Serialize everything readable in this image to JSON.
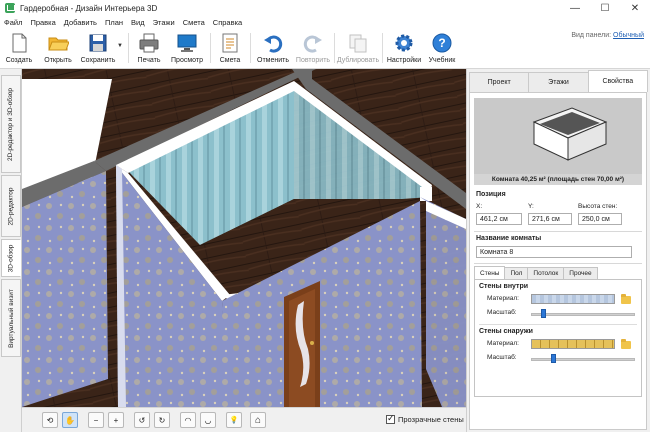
{
  "window": {
    "title": "Гардеробная - Дизайн Интерьера 3D",
    "controls": {
      "minimize": "—",
      "maximize": "☐",
      "close": "✕"
    }
  },
  "menu": [
    "Файл",
    "Правка",
    "Добавить",
    "План",
    "Вид",
    "Этажи",
    "Смета",
    "Справка"
  ],
  "toolbar": {
    "buttons": [
      {
        "label": "Создать",
        "icon": "new-document-icon"
      },
      {
        "label": "Открыть",
        "icon": "open-folder-icon"
      },
      {
        "label": "Сохранить",
        "icon": "save-disk-icon"
      },
      {
        "label": "Печать",
        "icon": "printer-icon"
      },
      {
        "label": "Просмотр",
        "icon": "monitor-icon"
      },
      {
        "label": "Смета",
        "icon": "estimate-notepad-icon"
      },
      {
        "label": "Отменить",
        "icon": "undo-icon"
      },
      {
        "label": "Повторить",
        "icon": "redo-icon",
        "disabled": true
      },
      {
        "label": "Дублировать",
        "icon": "duplicate-icon",
        "disabled": true
      },
      {
        "label": "Настройки",
        "icon": "gear-icon"
      },
      {
        "label": "Учебник",
        "icon": "help-icon"
      }
    ],
    "view_panel_label": "Вид панели:",
    "view_panel_value": "Обычный"
  },
  "side_tabs": [
    "2D-редактор и 3D-обзор",
    "2D-редактор",
    "3D-обзор",
    "Виртуальный визит"
  ],
  "active_side_tab": 2,
  "bottom_toolbar": {
    "buttons": [
      {
        "icon": "rotate-360-icon",
        "glyph": "⟲"
      },
      {
        "icon": "hand-pan-icon",
        "glyph": "✋",
        "active": true
      },
      {
        "icon": "zoom-out-icon",
        "glyph": "−"
      },
      {
        "icon": "zoom-in-icon",
        "glyph": "+"
      },
      {
        "icon": "rotate-left-icon",
        "glyph": "↺"
      },
      {
        "icon": "rotate-right-icon",
        "glyph": "↻"
      },
      {
        "icon": "tilt-up-icon",
        "glyph": "◠"
      },
      {
        "icon": "tilt-down-icon",
        "glyph": "◡"
      },
      {
        "icon": "light-bulb-icon",
        "glyph": "💡"
      },
      {
        "icon": "home-icon",
        "glyph": "⌂"
      }
    ],
    "transparent_walls_label": "Прозрачные стены",
    "transparent_walls_checked": true
  },
  "right_panel": {
    "tabs": [
      "Проект",
      "Этажи",
      "Свойства"
    ],
    "active_tab": 2,
    "room_caption": "Комната 40,25 м²  (площадь стен 70,00 м²)",
    "position": {
      "title": "Позиция",
      "x_label": "X:",
      "x_value": "461,2 см",
      "y_label": "Y:",
      "y_value": "271,6 см",
      "h_label": "Высота стен:",
      "h_value": "250,0 см"
    },
    "room_name": {
      "title": "Название комнаты",
      "value": "Комната 8"
    },
    "sub_tabs": [
      "Стены",
      "Пол",
      "Потолок",
      "Прочее"
    ],
    "active_sub_tab": 0,
    "walls_inside": {
      "title": "Стены внутри",
      "material_label": "Материал:",
      "scale_label": "Масштаб:",
      "scale_value": 0.12
    },
    "walls_outside": {
      "title": "Стены снаружи",
      "material_label": "Материал:",
      "scale_label": "Масштаб:",
      "scale_value": 0.2
    }
  },
  "colors": {
    "accent": "#2c77d6",
    "wall_outer": "#8a93c8",
    "wall_inner": "#8cc0cc",
    "floor": "#3a2418",
    "wall_top": "#6c6c6c"
  }
}
